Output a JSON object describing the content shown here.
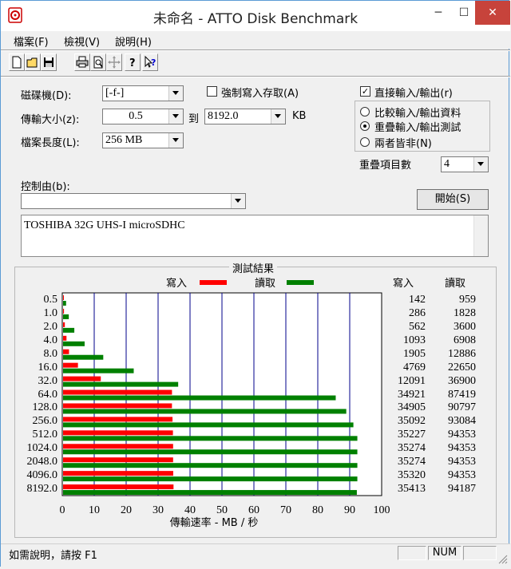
{
  "window": {
    "title": "未命名 - ATTO Disk Benchmark",
    "minimize_glyph": "─",
    "maximize_glyph": "☐",
    "close_glyph": "✕"
  },
  "menu": [
    "檔案(F)",
    "檢視(V)",
    "說明(H)"
  ],
  "toolbar": {
    "icons": [
      "new-file-icon",
      "open-folder-icon",
      "save-icon",
      "print-icon",
      "print-preview-icon",
      "move-icon",
      "help-icon",
      "context-help-icon"
    ]
  },
  "controls": {
    "drive_label": "磁碟機(D):",
    "drive_value": "[-f-]",
    "force_write_label": "強制寫入存取(A)",
    "force_write_checked": false,
    "transfer_size_label": "傳輸大小(z):",
    "transfer_from": "0.5",
    "to_label": "到",
    "transfer_to": "8192.0",
    "kb_label": "KB",
    "file_length_label": "檔案長度(L):",
    "file_length_value": "256 MB",
    "direct_io_label": "直接輸入/輸出(r)",
    "direct_io_checked": true,
    "radio_options": [
      {
        "label": "比較輸入/輸出資料",
        "selected": false
      },
      {
        "label": "重疊輸入/輸出測試",
        "selected": true
      },
      {
        "label": "兩者皆非(N)",
        "selected": false
      }
    ],
    "queue_depth_label": "重疊項目數",
    "queue_depth_value": "4",
    "controlled_by_label": "控制由(b):",
    "controlled_by_value": "",
    "start_button": "開始(S)",
    "description": "TOSHIBA 32G UHS-I microSDHC"
  },
  "results": {
    "title": "測試結果",
    "legend_write": "寫入",
    "legend_read": "讀取",
    "col_write": "寫入",
    "col_read": "讀取",
    "write_color": "#ff0000",
    "read_color": "#008000"
  },
  "chart_data": {
    "type": "bar",
    "orientation": "horizontal",
    "xlabel": "傳輸速率 - MB / 秒",
    "xlim": [
      0,
      100
    ],
    "x_ticks": [
      "0",
      "10",
      "20",
      "30",
      "40",
      "50",
      "60",
      "70",
      "80",
      "90",
      "100"
    ],
    "categories": [
      "0.5",
      "1.0",
      "2.0",
      "4.0",
      "8.0",
      "16.0",
      "32.0",
      "64.0",
      "128.0",
      "256.0",
      "512.0",
      "1024.0",
      "2048.0",
      "4096.0",
      "8192.0"
    ],
    "series": [
      {
        "name": "寫入",
        "values": [
          0.14,
          0.28,
          0.55,
          1.07,
          1.86,
          4.66,
          11.81,
          34.1,
          34.09,
          34.27,
          34.4,
          34.45,
          34.45,
          34.49,
          34.58
        ]
      },
      {
        "name": "讀取",
        "values": [
          0.94,
          1.79,
          3.52,
          6.75,
          12.58,
          22.12,
          36.04,
          85.37,
          88.67,
          90.9,
          92.14,
          92.14,
          92.14,
          92.14,
          91.98
        ]
      }
    ],
    "write_kbps": [
      "142",
      "286",
      "562",
      "1093",
      "1905",
      "4769",
      "12091",
      "34921",
      "34905",
      "35092",
      "35227",
      "35274",
      "35274",
      "35320",
      "35413"
    ],
    "read_kbps": [
      "959",
      "1828",
      "3600",
      "6908",
      "12886",
      "22650",
      "36900",
      "87419",
      "90797",
      "93084",
      "94353",
      "94353",
      "94353",
      "94353",
      "94187"
    ]
  },
  "statusbar": {
    "help_text": "如需說明，請按 F1",
    "num": "NUM"
  }
}
